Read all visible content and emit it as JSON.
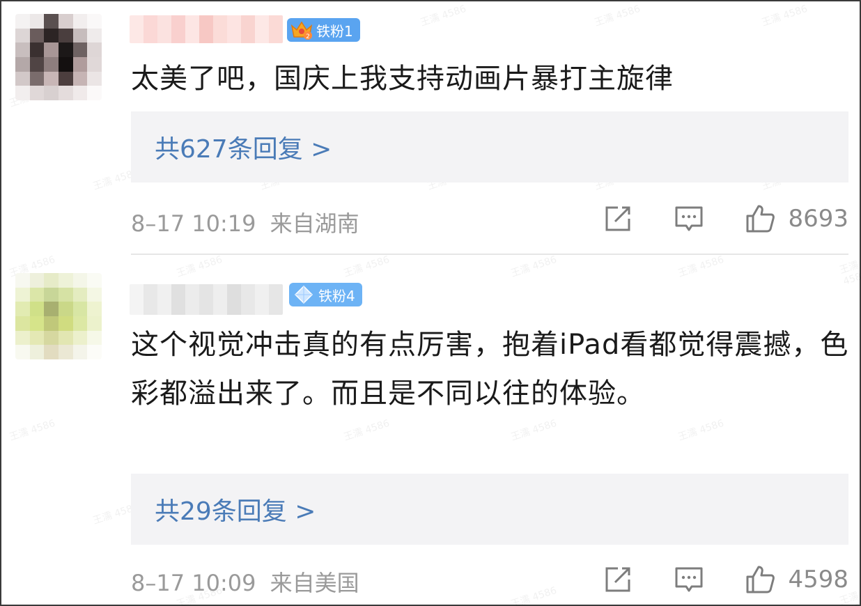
{
  "comments": [
    {
      "badge": "铁粉1",
      "text": "太美了吧，国庆上我支持动画片暴打主旋律",
      "replies": "共627条回复 >",
      "time": "8–17 10:19",
      "location": "来自湖南",
      "likes": "8693"
    },
    {
      "badge": "铁粉4",
      "text": "这个视觉冲击真的有点厉害，抱着iPad看都觉得震撼，色彩都溢出来了。而且是不同以往的体验。",
      "replies": "共29条回复 >",
      "time": "8–17 10:09",
      "location": "来自美国",
      "likes": "4598"
    }
  ],
  "watermark": "王濡 4586",
  "icons": {
    "share": "share-icon",
    "comment": "comment-icon",
    "like": "thumbs-up-icon",
    "badge1": "crown-icon",
    "badge2": "diamond-icon"
  }
}
